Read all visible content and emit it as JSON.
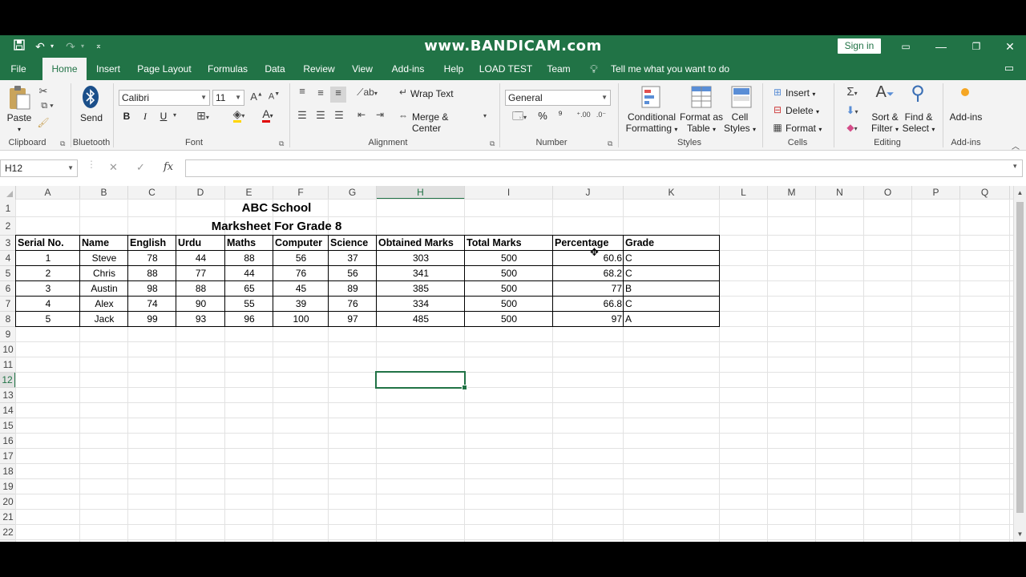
{
  "watermark": "www.BANDICAM.com",
  "titlebar": {
    "save_icon": "save-icon",
    "undo_icon": "undo-icon",
    "redo_icon": "redo-icon",
    "customize_icon": "customize-qat-icon",
    "signin_label": "Sign in",
    "ribbon_display_icon": "ribbon-display-options-icon",
    "minimize": "—",
    "restore": "❐",
    "close": "✕"
  },
  "tabs": [
    {
      "label": "File"
    },
    {
      "label": "Home"
    },
    {
      "label": "Insert"
    },
    {
      "label": "Page Layout"
    },
    {
      "label": "Formulas"
    },
    {
      "label": "Data"
    },
    {
      "label": "Review"
    },
    {
      "label": "View"
    },
    {
      "label": "Add-ins"
    },
    {
      "label": "Help"
    },
    {
      "label": "LOAD TEST"
    },
    {
      "label": "Team"
    }
  ],
  "active_tab": "Home",
  "tellme": "Tell me what you want to do",
  "ribbon": {
    "clipboard": {
      "paste": "Paste",
      "label": "Clipboard"
    },
    "bluetooth": {
      "send": "Send",
      "label": "Bluetooth"
    },
    "font": {
      "name": "Calibri",
      "size": "11",
      "label": "Font",
      "bold": "B",
      "italic": "I",
      "underline": "U"
    },
    "alignment": {
      "wrap": "Wrap Text",
      "merge": "Merge & Center",
      "label": "Alignment"
    },
    "number": {
      "format": "General",
      "percent": "%",
      "comma": "⁹",
      "label": "Number"
    },
    "styles": {
      "cond1": "Conditional",
      "cond2": "Formatting",
      "fmt1": "Format as",
      "fmt2": "Table",
      "cell1": "Cell",
      "cell2": "Styles",
      "label": "Styles"
    },
    "cells": {
      "insert": "Insert",
      "delete": "Delete",
      "format": "Format",
      "label": "Cells"
    },
    "editing": {
      "sort1": "Sort &",
      "sort2": "Filter",
      "find1": "Find &",
      "find2": "Select",
      "label": "Editing"
    },
    "addins": {
      "btn": "Add-ins",
      "label": "Add-ins"
    }
  },
  "formula_bar": {
    "name_box": "H12",
    "fx": "fx",
    "cancel": "✕",
    "enter": "✓",
    "value": ""
  },
  "columns": [
    "A",
    "B",
    "C",
    "D",
    "E",
    "F",
    "G",
    "H",
    "I",
    "J",
    "K",
    "L",
    "M",
    "N",
    "O",
    "P",
    "Q"
  ],
  "rows": [
    "1",
    "2",
    "3",
    "4",
    "5",
    "6",
    "7",
    "8",
    "9",
    "10",
    "11",
    "12",
    "13",
    "14",
    "15",
    "16",
    "17",
    "18",
    "19",
    "20",
    "21",
    "22"
  ],
  "selected_cell": "H12",
  "sheet": {
    "title": "ABC School",
    "subtitle": "Marksheet For Grade 8",
    "headers": [
      "Serial No.",
      "Name",
      "English",
      "Urdu",
      "Maths",
      "Computer",
      "Science",
      "Obtained Marks",
      "Total Marks",
      "Percentage",
      "Grade"
    ],
    "data": [
      [
        "1",
        "Steve",
        "78",
        "44",
        "88",
        "56",
        "37",
        "303",
        "500",
        "60.6",
        "C"
      ],
      [
        "2",
        "Chris",
        "88",
        "77",
        "44",
        "76",
        "56",
        "341",
        "500",
        "68.2",
        "C"
      ],
      [
        "3",
        "Austin",
        "98",
        "88",
        "65",
        "45",
        "89",
        "385",
        "500",
        "77",
        "B"
      ],
      [
        "4",
        "Alex",
        "74",
        "90",
        "55",
        "39",
        "76",
        "334",
        "500",
        "66.8",
        "C"
      ],
      [
        "5",
        "Jack",
        "99",
        "93",
        "96",
        "100",
        "97",
        "485",
        "500",
        "97",
        "A"
      ]
    ]
  },
  "colors": {
    "accent": "#217346",
    "ribbon_bg": "#f3f3f3"
  }
}
